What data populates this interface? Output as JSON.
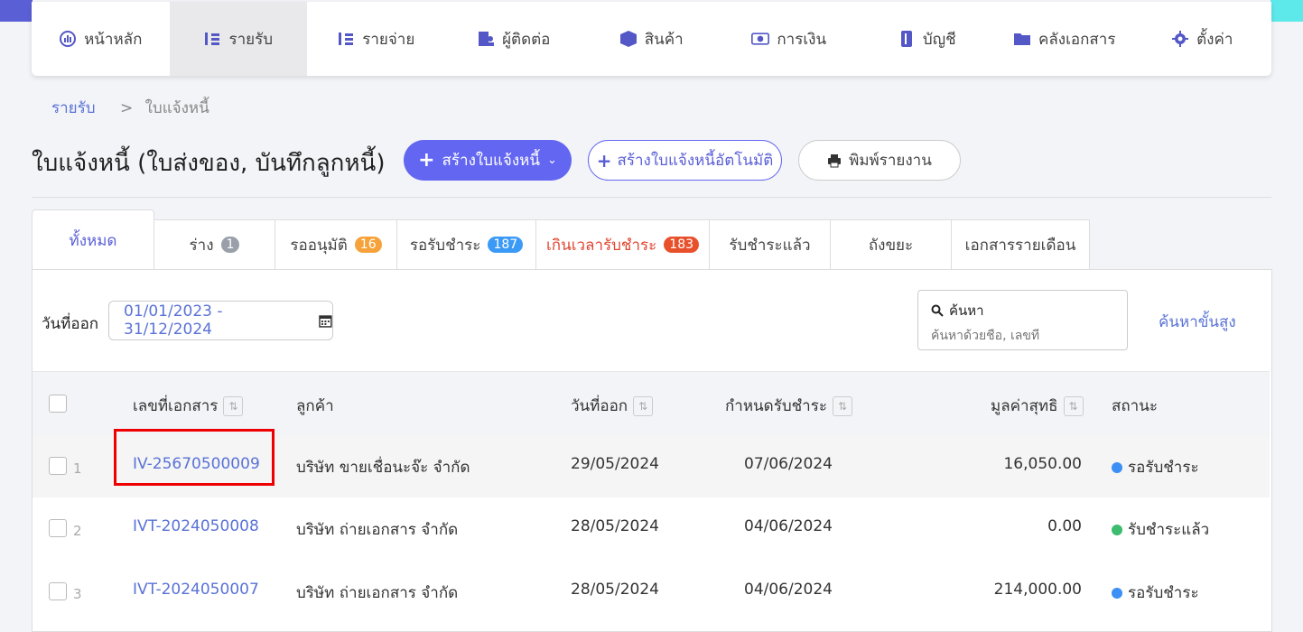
{
  "nav": {
    "items": [
      {
        "label": "หน้าหลัก",
        "icon": "dashboard-icon"
      },
      {
        "label": "รายรับ",
        "icon": "income-icon",
        "active": true
      },
      {
        "label": "รายจ่าย",
        "icon": "expense-icon"
      },
      {
        "label": "ผู้ติดต่อ",
        "icon": "contacts-icon"
      },
      {
        "label": "สินค้า",
        "icon": "box-icon"
      },
      {
        "label": "การเงิน",
        "icon": "money-icon"
      },
      {
        "label": "บัญชี",
        "icon": "ledger-icon"
      },
      {
        "label": "คลังเอกสาร",
        "icon": "folder-icon"
      },
      {
        "label": "ตั้งค่า",
        "icon": "gear-icon"
      }
    ]
  },
  "breadcrumb": {
    "parent": "รายรับ",
    "separator": ">",
    "current": "ใบแจ้งหนี้"
  },
  "page": {
    "title": "ใบแจ้งหนี้ (ใบส่งของ, บันทึกลูกหนี้)",
    "create_label": "สร้างใบแจ้งหนี้",
    "auto_create_label": "สร้างใบแจ้งหนี้อัตโนมัติ",
    "print_label": "พิมพ์รายงาน"
  },
  "tabs": [
    {
      "label": "ทั้งหมด",
      "active": true
    },
    {
      "label": "ร่าง",
      "count": "1"
    },
    {
      "label": "รออนุมัติ",
      "count": "16"
    },
    {
      "label": "รอรับชำระ",
      "count": "187"
    },
    {
      "label": "เกินเวลารับชำระ",
      "count": "183"
    },
    {
      "label": "รับชำระแล้ว"
    },
    {
      "label": "ถังขยะ"
    },
    {
      "label": "เอกสารรายเดือน"
    }
  ],
  "filters": {
    "date_label": "วันที่ออก",
    "date_range": "01/01/2023 - 31/12/2024",
    "search_title": "ค้นหา",
    "search_placeholder": "ค้นหาด้วยชื่อ, เลขที่",
    "advanced_search": "ค้นหาขั้นสูง"
  },
  "table": {
    "headers": {
      "doc": "เลขที่เอกสาร",
      "customer": "ลูกค้า",
      "issue": "วันที่ออก",
      "due": "กำหนดรับชำระ",
      "amount": "มูลค่าสุทธิ",
      "status": "สถานะ"
    },
    "rows": [
      {
        "num": "1",
        "doc": "IV-25670500009",
        "customer": "บริษัท ขายเชื่อนะจ๊ะ จำกัด",
        "issue": "29/05/2024",
        "due": "07/06/2024",
        "amount": "16,050.00",
        "status": "รอรับชำระ",
        "status_color": "#3b8ff5"
      },
      {
        "num": "2",
        "doc": "IVT-2024050008",
        "customer": "บริษัท ถ่ายเอกสาร จำกัด",
        "issue": "28/05/2024",
        "due": "04/06/2024",
        "amount": "0.00",
        "status": "รับชำระแล้ว",
        "status_color": "#3dbb6e"
      },
      {
        "num": "3",
        "doc": "IVT-2024050007",
        "customer": "บริษัท ถ่ายเอกสาร จำกัด",
        "issue": "28/05/2024",
        "due": "04/06/2024",
        "amount": "214,000.00",
        "status": "รอรับชำระ",
        "status_color": "#3b8ff5"
      }
    ]
  }
}
